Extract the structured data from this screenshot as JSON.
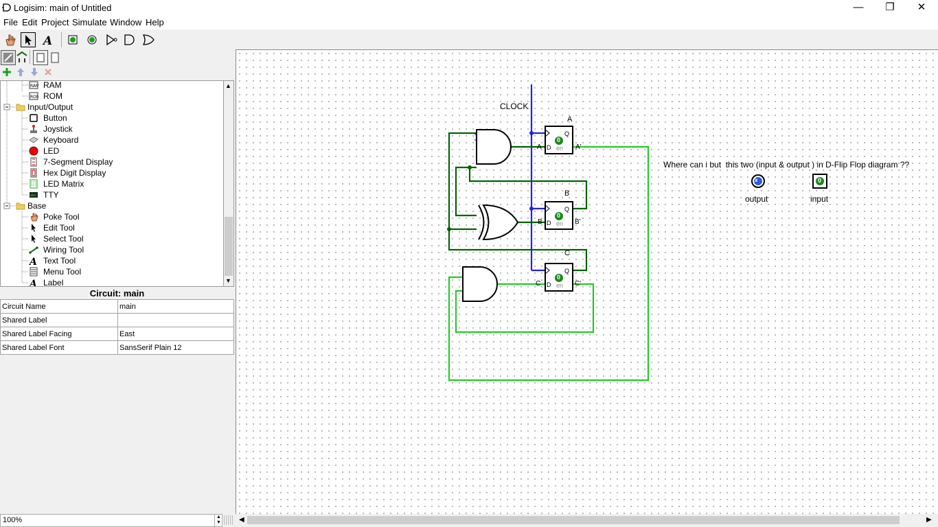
{
  "window": {
    "title": "Logisim: main of Untitled"
  },
  "menu": [
    "File",
    "Edit",
    "Project",
    "Simulate",
    "Window",
    "Help"
  ],
  "toolbar": {
    "icons": [
      "poke-tool-icon",
      "select-tool-icon",
      "text-tool-icon",
      "input-pin-icon",
      "output-pin-icon",
      "not-gate-icon",
      "and-gate-icon",
      "or-gate-icon"
    ]
  },
  "tree": {
    "items": [
      {
        "label": "RAM",
        "icon": "ram-icon",
        "level": 2
      },
      {
        "label": "ROM",
        "icon": "rom-icon",
        "level": 2
      },
      {
        "label": "Input/Output",
        "icon": "folder-icon",
        "level": 1
      },
      {
        "label": "Button",
        "icon": "button-icon",
        "level": 2
      },
      {
        "label": "Joystick",
        "icon": "joystick-icon",
        "level": 2
      },
      {
        "label": "Keyboard",
        "icon": "keyboard-icon",
        "level": 2
      },
      {
        "label": "LED",
        "icon": "led-icon",
        "level": 2
      },
      {
        "label": "7-Segment Display",
        "icon": "seven-segment-icon",
        "level": 2
      },
      {
        "label": "Hex Digit Display",
        "icon": "hex-display-icon",
        "level": 2
      },
      {
        "label": "LED Matrix",
        "icon": "led-matrix-icon",
        "level": 2
      },
      {
        "label": "TTY",
        "icon": "tty-icon",
        "level": 2
      },
      {
        "label": "Base",
        "icon": "folder-icon",
        "level": 1
      },
      {
        "label": "Poke Tool",
        "icon": "poke-tool-icon",
        "level": 2
      },
      {
        "label": "Edit Tool",
        "icon": "edit-tool-icon",
        "level": 2
      },
      {
        "label": "Select Tool",
        "icon": "select-tool-icon",
        "level": 2
      },
      {
        "label": "Wiring Tool",
        "icon": "wiring-tool-icon",
        "level": 2
      },
      {
        "label": "Text Tool",
        "icon": "text-tool-icon",
        "level": 2
      },
      {
        "label": "Menu Tool",
        "icon": "menu-tool-icon",
        "level": 2
      },
      {
        "label": "Label",
        "icon": "label-icon",
        "level": 2
      }
    ]
  },
  "properties": {
    "title": "Circuit: main",
    "rows": [
      {
        "name": "Circuit Name",
        "value": "main"
      },
      {
        "name": "Shared Label",
        "value": ""
      },
      {
        "name": "Shared Label Facing",
        "value": "East"
      },
      {
        "name": "Shared Label Font",
        "value": "SansSerif Plain 12"
      }
    ]
  },
  "zoom": "100%",
  "circuit": {
    "clock_label": "CLOCK",
    "ff_labels": [
      "A",
      "B",
      "C"
    ],
    "ff_inputs": [
      "A",
      "B",
      "C"
    ],
    "ff_outputs": [
      "A'",
      "B'",
      "C'"
    ],
    "ff_state": "0",
    "ff_q": "Q",
    "ff_d": "D",
    "ff_en": "en",
    "question": "Where can i but  this two (input & output ) in D-Flip Flop diagram ??",
    "output_label": "output",
    "input_label": "input",
    "input_value": "0",
    "output_value": "x"
  },
  "colors": {
    "wire_dark": "#006400",
    "wire_light": "#22cc22",
    "clock_wire": "#2222dd"
  }
}
